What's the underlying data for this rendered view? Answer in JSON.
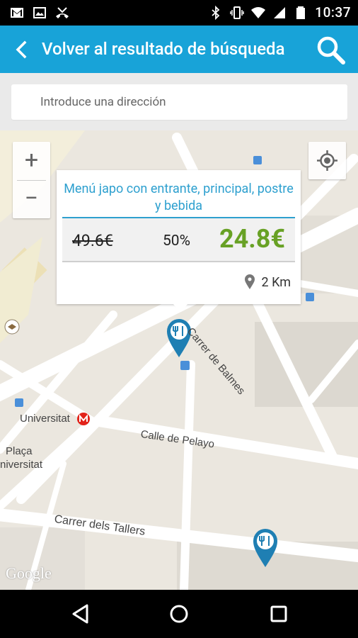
{
  "status_bar": {
    "time": "10:37",
    "left_icons": [
      "gmail-icon",
      "gallery-icon",
      "missed-call-icon"
    ],
    "right_icons": [
      "bluetooth-icon",
      "vibrate-icon",
      "wifi-icon",
      "signal-icon",
      "battery-icon"
    ]
  },
  "app_bar": {
    "title": "Volver al resultado de búsqueda",
    "back_icon": "back-arrow-icon",
    "search_icon": "search-icon",
    "background": "#18a3d8"
  },
  "address_search": {
    "placeholder": "Introduce una dirección"
  },
  "map": {
    "zoom_in_label": "+",
    "zoom_out_label": "−",
    "street_labels": [
      "Carrer de Balmes",
      "Calle de Pelayo",
      "Carrer dels Tallers"
    ],
    "place_labels": [
      "Universitat",
      "Plaça",
      "niversitat"
    ],
    "attribution": "Google"
  },
  "offer_popup": {
    "title": "Menú japo con entrante, principal, postre y bebida",
    "old_price": "49.6€",
    "discount": "50%",
    "new_price": "24.8€",
    "distance": "2 Km",
    "title_color": "#2ea0cf",
    "price_color": "#68a125"
  },
  "nav_bar": {
    "back": "back-triangle-icon",
    "home": "home-circle-icon",
    "recents": "recents-square-icon"
  }
}
